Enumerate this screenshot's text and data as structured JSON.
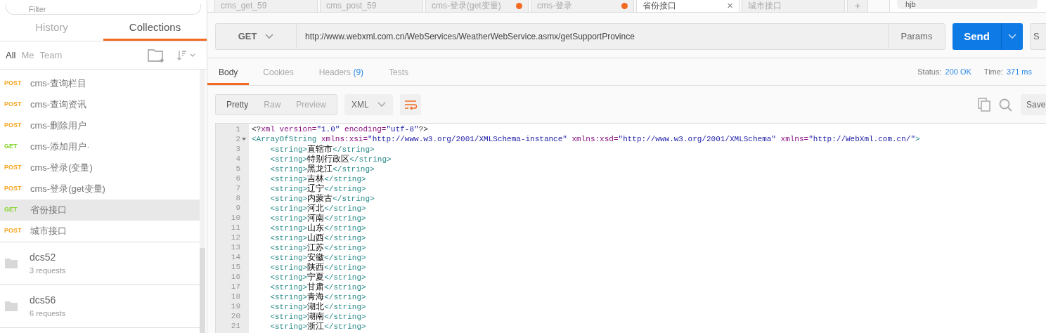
{
  "sidebar": {
    "filter": {
      "placeholder": "Filter"
    },
    "tabs": [
      {
        "label": "History",
        "selected": false
      },
      {
        "label": "Collections",
        "selected": true
      }
    ],
    "owner_filters": [
      {
        "label": "All",
        "selected": true
      },
      {
        "label": "Me",
        "selected": false
      },
      {
        "label": "Team",
        "selected": false
      }
    ],
    "requests": [
      {
        "method": "POST",
        "name": "cms-查询栏目",
        "selected": false
      },
      {
        "method": "POST",
        "name": "cms-查询资讯",
        "selected": false
      },
      {
        "method": "POST",
        "name": "cms-删除用户",
        "selected": false
      },
      {
        "method": "GET",
        "name": "cms-添加用户·",
        "selected": false
      },
      {
        "method": "POST",
        "name": "cms-登录(变量)",
        "selected": false
      },
      {
        "method": "POST",
        "name": "cms-登录(get变量)",
        "selected": false
      },
      {
        "method": "GET",
        "name": "省份接口",
        "selected": true
      },
      {
        "method": "POST",
        "name": "城市接口",
        "selected": false
      }
    ],
    "collections": [
      {
        "name": "dcs52",
        "count": "3 requests"
      },
      {
        "name": "dcs56",
        "count": "6 requests"
      }
    ]
  },
  "request_tabs": [
    {
      "label": "cms_get_59",
      "selected": false,
      "unsaved": false
    },
    {
      "label": "cms_post_59",
      "selected": false,
      "unsaved": false
    },
    {
      "label": "cms-登录(get变量)",
      "selected": false,
      "unsaved": true
    },
    {
      "label": "cms-登录",
      "selected": false,
      "unsaved": true
    },
    {
      "label": "省份接口",
      "selected": true,
      "unsaved": false
    },
    {
      "label": "城市接口",
      "selected": false,
      "unsaved": false
    }
  ],
  "new_tab": "+",
  "close": "×",
  "environment_field": {
    "value": "hjb"
  },
  "request": {
    "method": "GET",
    "url": "http://www.webxml.com.cn/WebServices/WeatherWebService.asmx/getSupportProvince",
    "params": "Params",
    "send": "Send",
    "save": "S"
  },
  "response_tabs": [
    {
      "label": "Body",
      "selected": true
    },
    {
      "label": "Cookies",
      "selected": false
    },
    {
      "label": "Headers",
      "count": "(9)",
      "selected": false
    },
    {
      "label": "Tests",
      "selected": false
    }
  ],
  "status": {
    "label": "Status:",
    "value": "200 OK"
  },
  "time": {
    "label": "Time:",
    "value": "371 ms"
  },
  "views": [
    {
      "label": "Pretty",
      "selected": true
    },
    {
      "label": "Raw",
      "selected": false
    },
    {
      "label": "Preview",
      "selected": false
    }
  ],
  "format": "XML",
  "wrap": true,
  "save_response": "Save",
  "code": [
    {
      "number": "1",
      "fold": false,
      "tokens": [
        {
          "kind": "punct",
          "text": "<?"
        },
        {
          "kind": "attr",
          "text": "xml version="
        },
        {
          "kind": "value",
          "text": "\"1.0\""
        },
        {
          "kind": "attr",
          "text": " encoding="
        },
        {
          "kind": "value",
          "text": "\"utf-8\""
        },
        {
          "kind": "punct",
          "text": "?>"
        }
      ]
    },
    {
      "number": "2",
      "fold": true,
      "tokens": [
        {
          "kind": "tag",
          "text": "<ArrayOfString"
        },
        {
          "kind": "attr",
          "text": " xmlns:xsi="
        },
        {
          "kind": "value",
          "text": "\"http://www.w3.org/2001/XMLSchema-instance\""
        },
        {
          "kind": "attr",
          "text": " xmlns:xsd="
        },
        {
          "kind": "value",
          "text": "\"http://www.w3.org/2001/XMLSchema\""
        },
        {
          "kind": "attr",
          "text": " xmlns="
        },
        {
          "kind": "value",
          "text": "\"http://WebXml.com.cn/\""
        },
        {
          "kind": "tag",
          "text": ">"
        }
      ]
    },
    {
      "number": "3",
      "fold": false,
      "tokens": [
        {
          "kind": "tag",
          "text": "    <string>"
        },
        {
          "kind": "text",
          "text": "直辖市"
        },
        {
          "kind": "tag",
          "text": "</string>"
        }
      ]
    },
    {
      "number": "4",
      "fold": false,
      "tokens": [
        {
          "kind": "tag",
          "text": "    <string>"
        },
        {
          "kind": "text",
          "text": "特别行政区"
        },
        {
          "kind": "tag",
          "text": "</string>"
        }
      ]
    },
    {
      "number": "5",
      "fold": false,
      "tokens": [
        {
          "kind": "tag",
          "text": "    <string>"
        },
        {
          "kind": "text",
          "text": "黑龙江"
        },
        {
          "kind": "tag",
          "text": "</string>"
        }
      ]
    },
    {
      "number": "6",
      "fold": false,
      "tokens": [
        {
          "kind": "tag",
          "text": "    <string>"
        },
        {
          "kind": "text",
          "text": "吉林"
        },
        {
          "kind": "tag",
          "text": "</string>"
        }
      ]
    },
    {
      "number": "7",
      "fold": false,
      "tokens": [
        {
          "kind": "tag",
          "text": "    <string>"
        },
        {
          "kind": "text",
          "text": "辽宁"
        },
        {
          "kind": "tag",
          "text": "</string>"
        }
      ]
    },
    {
      "number": "8",
      "fold": false,
      "tokens": [
        {
          "kind": "tag",
          "text": "    <string>"
        },
        {
          "kind": "text",
          "text": "内蒙古"
        },
        {
          "kind": "tag",
          "text": "</string>"
        }
      ]
    },
    {
      "number": "9",
      "fold": false,
      "tokens": [
        {
          "kind": "tag",
          "text": "    <string>"
        },
        {
          "kind": "text",
          "text": "河北"
        },
        {
          "kind": "tag",
          "text": "</string>"
        }
      ]
    },
    {
      "number": "10",
      "fold": false,
      "tokens": [
        {
          "kind": "tag",
          "text": "    <string>"
        },
        {
          "kind": "text",
          "text": "河南"
        },
        {
          "kind": "tag",
          "text": "</string>"
        }
      ]
    },
    {
      "number": "11",
      "fold": false,
      "tokens": [
        {
          "kind": "tag",
          "text": "    <string>"
        },
        {
          "kind": "text",
          "text": "山东"
        },
        {
          "kind": "tag",
          "text": "</string>"
        }
      ]
    },
    {
      "number": "12",
      "fold": false,
      "tokens": [
        {
          "kind": "tag",
          "text": "    <string>"
        },
        {
          "kind": "text",
          "text": "山西"
        },
        {
          "kind": "tag",
          "text": "</string>"
        }
      ]
    },
    {
      "number": "13",
      "fold": false,
      "tokens": [
        {
          "kind": "tag",
          "text": "    <string>"
        },
        {
          "kind": "text",
          "text": "江苏"
        },
        {
          "kind": "tag",
          "text": "</string>"
        }
      ]
    },
    {
      "number": "14",
      "fold": false,
      "tokens": [
        {
          "kind": "tag",
          "text": "    <string>"
        },
        {
          "kind": "text",
          "text": "安徽"
        },
        {
          "kind": "tag",
          "text": "</string>"
        }
      ]
    },
    {
      "number": "15",
      "fold": false,
      "tokens": [
        {
          "kind": "tag",
          "text": "    <string>"
        },
        {
          "kind": "text",
          "text": "陕西"
        },
        {
          "kind": "tag",
          "text": "</string>"
        }
      ]
    },
    {
      "number": "16",
      "fold": false,
      "tokens": [
        {
          "kind": "tag",
          "text": "    <string>"
        },
        {
          "kind": "text",
          "text": "宁夏"
        },
        {
          "kind": "tag",
          "text": "</string>"
        }
      ]
    },
    {
      "number": "17",
      "fold": false,
      "tokens": [
        {
          "kind": "tag",
          "text": "    <string>"
        },
        {
          "kind": "text",
          "text": "甘肃"
        },
        {
          "kind": "tag",
          "text": "</string>"
        }
      ]
    },
    {
      "number": "18",
      "fold": false,
      "tokens": [
        {
          "kind": "tag",
          "text": "    <string>"
        },
        {
          "kind": "text",
          "text": "青海"
        },
        {
          "kind": "tag",
          "text": "</string>"
        }
      ]
    },
    {
      "number": "19",
      "fold": false,
      "tokens": [
        {
          "kind": "tag",
          "text": "    <string>"
        },
        {
          "kind": "text",
          "text": "湖北"
        },
        {
          "kind": "tag",
          "text": "</string>"
        }
      ]
    },
    {
      "number": "20",
      "fold": false,
      "tokens": [
        {
          "kind": "tag",
          "text": "    <string>"
        },
        {
          "kind": "text",
          "text": "湖南"
        },
        {
          "kind": "tag",
          "text": "</string>"
        }
      ]
    },
    {
      "number": "21",
      "fold": false,
      "tokens": [
        {
          "kind": "tag",
          "text": "    <string>"
        },
        {
          "kind": "text",
          "text": "浙江"
        },
        {
          "kind": "tag",
          "text": "</string>"
        }
      ]
    }
  ]
}
